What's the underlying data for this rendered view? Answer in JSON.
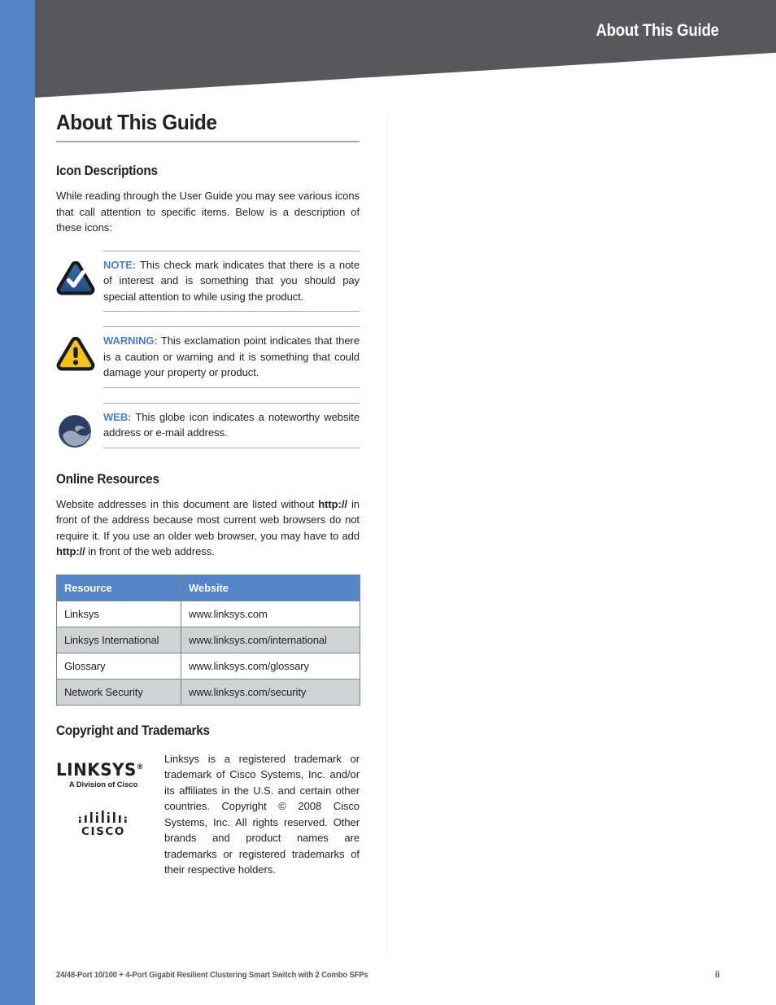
{
  "header": {
    "running_title": "About This Guide"
  },
  "page": {
    "title": "About This Guide"
  },
  "icon_descriptions": {
    "heading": "Icon Descriptions",
    "intro": "While reading through the User Guide you may see various icons that call attention to specific items. Below is a description of these icons:",
    "notes": [
      {
        "icon": "note-checkmark-triangle-icon",
        "label": "NOTE:",
        "text": "This check mark indicates that there is a note of interest and is something that you should pay special attention to while using the product."
      },
      {
        "icon": "warning-exclamation-triangle-icon",
        "label": "WARNING:",
        "text": "This exclamation point indicates that there is a caution or warning and it is something that could damage your property or product."
      },
      {
        "icon": "web-globe-icon",
        "label": "WEB:",
        "text": "This globe icon indicates a noteworthy website address or e-mail address."
      }
    ]
  },
  "online_resources": {
    "heading": "Online Resources",
    "paragraph_part1": "Website addresses in this document are listed without ",
    "paragraph_bold1": "http://",
    "paragraph_part2": " in front of the address because most current web browsers do not require it. If you use an older web browser, you may have to add ",
    "paragraph_bold2": "http://",
    "paragraph_part3": " in front of the web address.",
    "table": {
      "columns": [
        "Resource",
        "Website"
      ],
      "rows": [
        [
          "Linksys",
          "www.linksys.com"
        ],
        [
          "Linksys International",
          "www.linksys.com/international"
        ],
        [
          "Glossary",
          "www.linksys.com/glossary"
        ],
        [
          "Network Security",
          "www.linksys.com/security"
        ]
      ]
    }
  },
  "copyright": {
    "heading": "Copyright and Trademarks",
    "linksys_logo": {
      "wordmark": "LINKSYS",
      "registered": "®",
      "tagline": "A Division of Cisco"
    },
    "cisco_logo": {
      "wordmark": "CISCO"
    },
    "text": "Linksys is a registered trademark or trademark of Cisco Systems, Inc. and/or its affiliates in the U.S. and certain other countries. Copyright © 2008 Cisco Systems, Inc. All rights reserved. Other brands and product names are trademarks or registered trademarks of their respective holders."
  },
  "footer": {
    "product": "24/48-Port 10/100 + 4-Port Gigabit Resilient Clustering Smart Switch with 2 Combo SFPs",
    "page_number": "ii"
  },
  "colors": {
    "spine_blue": "#5485c8",
    "header_gray": "#58585a",
    "accent_blue": "#4a7fc1",
    "table_header_blue": "#5485c8",
    "table_alt_row": "#d1d3d4",
    "rule_gray": "#a7a9ac",
    "warning_yellow": "#f5c216",
    "globe_navy": "#2b3f63"
  }
}
